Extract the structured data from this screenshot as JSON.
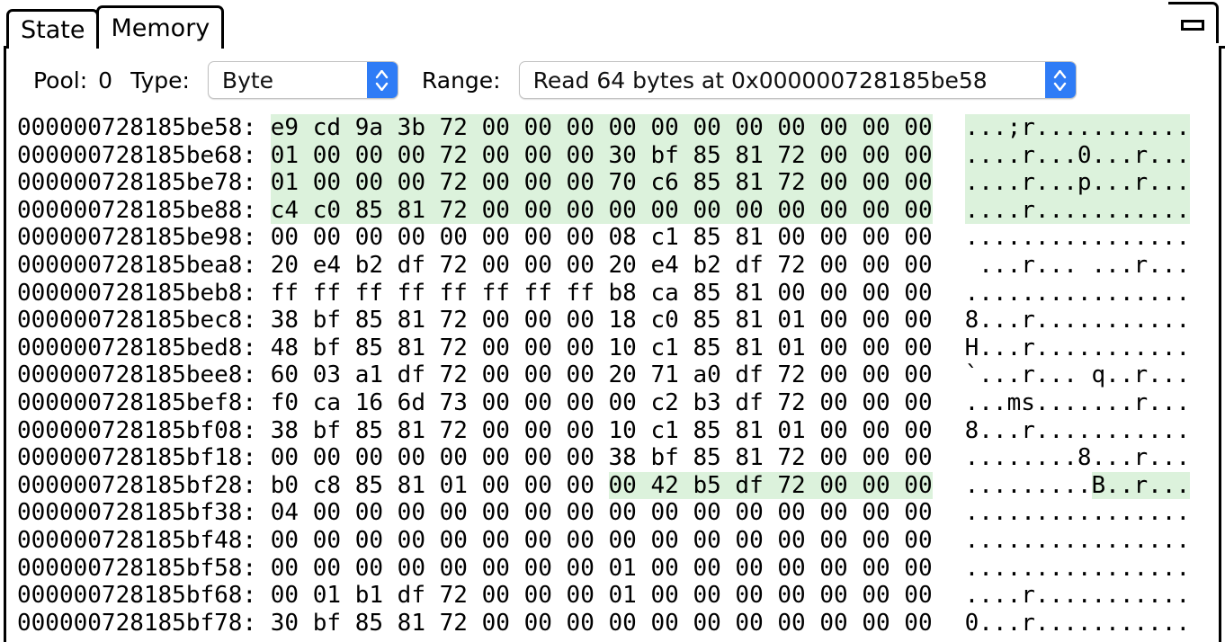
{
  "window": {
    "minimize_icon": "minimize-icon"
  },
  "tabs": [
    {
      "label": "State",
      "active": false
    },
    {
      "label": "Memory",
      "active": true
    }
  ],
  "toolbar": {
    "pool_label": "Pool:",
    "pool_value": "0",
    "type_label": "Type:",
    "type_value": "Byte",
    "type_options": [
      "Byte"
    ],
    "range_label": "Range:",
    "range_value": "Read 64 bytes at 0x000000728185be58",
    "range_options": [
      "Read 64 bytes at 0x000000728185be58"
    ],
    "stepper_icon": "chevron-up-down-icon"
  },
  "memory": {
    "highlight_color": "#dcf2dc",
    "bytes_per_row": 16,
    "rows": [
      {
        "address": "000000728185be58:",
        "bytes": [
          "e9",
          "cd",
          "9a",
          "3b",
          "72",
          "00",
          "00",
          "00",
          "00",
          "00",
          "00",
          "00",
          "00",
          "00",
          "00",
          "00"
        ],
        "ascii": "...;r...........",
        "hex_highlight": [
          0,
          16
        ],
        "ascii_highlight": [
          0,
          16
        ]
      },
      {
        "address": "000000728185be68:",
        "bytes": [
          "01",
          "00",
          "00",
          "00",
          "72",
          "00",
          "00",
          "00",
          "30",
          "bf",
          "85",
          "81",
          "72",
          "00",
          "00",
          "00"
        ],
        "ascii": "....r...0...r...",
        "hex_highlight": [
          0,
          16
        ],
        "ascii_highlight": [
          0,
          16
        ]
      },
      {
        "address": "000000728185be78:",
        "bytes": [
          "01",
          "00",
          "00",
          "00",
          "72",
          "00",
          "00",
          "00",
          "70",
          "c6",
          "85",
          "81",
          "72",
          "00",
          "00",
          "00"
        ],
        "ascii": "....r...p...r...",
        "hex_highlight": [
          0,
          16
        ],
        "ascii_highlight": [
          0,
          16
        ]
      },
      {
        "address": "000000728185be88:",
        "bytes": [
          "c4",
          "c0",
          "85",
          "81",
          "72",
          "00",
          "00",
          "00",
          "00",
          "00",
          "00",
          "00",
          "00",
          "00",
          "00",
          "00"
        ],
        "ascii": "....r...........",
        "hex_highlight": [
          0,
          16
        ],
        "ascii_highlight": [
          0,
          16
        ]
      },
      {
        "address": "000000728185be98:",
        "bytes": [
          "00",
          "00",
          "00",
          "00",
          "00",
          "00",
          "00",
          "00",
          "08",
          "c1",
          "85",
          "81",
          "00",
          "00",
          "00",
          "00"
        ],
        "ascii": "................",
        "hex_highlight": null,
        "ascii_highlight": null
      },
      {
        "address": "000000728185bea8:",
        "bytes": [
          "20",
          "e4",
          "b2",
          "df",
          "72",
          "00",
          "00",
          "00",
          "20",
          "e4",
          "b2",
          "df",
          "72",
          "00",
          "00",
          "00"
        ],
        "ascii": " ...r... ...r...",
        "hex_highlight": null,
        "ascii_highlight": null
      },
      {
        "address": "000000728185beb8:",
        "bytes": [
          "ff",
          "ff",
          "ff",
          "ff",
          "ff",
          "ff",
          "ff",
          "ff",
          "b8",
          "ca",
          "85",
          "81",
          "00",
          "00",
          "00",
          "00"
        ],
        "ascii": "................",
        "hex_highlight": null,
        "ascii_highlight": null
      },
      {
        "address": "000000728185bec8:",
        "bytes": [
          "38",
          "bf",
          "85",
          "81",
          "72",
          "00",
          "00",
          "00",
          "18",
          "c0",
          "85",
          "81",
          "01",
          "00",
          "00",
          "00"
        ],
        "ascii": "8...r...........",
        "hex_highlight": null,
        "ascii_highlight": null
      },
      {
        "address": "000000728185bed8:",
        "bytes": [
          "48",
          "bf",
          "85",
          "81",
          "72",
          "00",
          "00",
          "00",
          "10",
          "c1",
          "85",
          "81",
          "01",
          "00",
          "00",
          "00"
        ],
        "ascii": "H...r...........",
        "hex_highlight": null,
        "ascii_highlight": null
      },
      {
        "address": "000000728185bee8:",
        "bytes": [
          "60",
          "03",
          "a1",
          "df",
          "72",
          "00",
          "00",
          "00",
          "20",
          "71",
          "a0",
          "df",
          "72",
          "00",
          "00",
          "00"
        ],
        "ascii": "`...r... q..r...",
        "hex_highlight": null,
        "ascii_highlight": null
      },
      {
        "address": "000000728185bef8:",
        "bytes": [
          "f0",
          "ca",
          "16",
          "6d",
          "73",
          "00",
          "00",
          "00",
          "00",
          "c2",
          "b3",
          "df",
          "72",
          "00",
          "00",
          "00"
        ],
        "ascii": "...ms.......r...",
        "hex_highlight": null,
        "ascii_highlight": null
      },
      {
        "address": "000000728185bf08:",
        "bytes": [
          "38",
          "bf",
          "85",
          "81",
          "72",
          "00",
          "00",
          "00",
          "10",
          "c1",
          "85",
          "81",
          "01",
          "00",
          "00",
          "00"
        ],
        "ascii": "8...r...........",
        "hex_highlight": null,
        "ascii_highlight": null
      },
      {
        "address": "000000728185bf18:",
        "bytes": [
          "00",
          "00",
          "00",
          "00",
          "00",
          "00",
          "00",
          "00",
          "38",
          "bf",
          "85",
          "81",
          "72",
          "00",
          "00",
          "00"
        ],
        "ascii": "........8...r...",
        "hex_highlight": null,
        "ascii_highlight": null
      },
      {
        "address": "000000728185bf28:",
        "bytes": [
          "b0",
          "c8",
          "85",
          "81",
          "01",
          "00",
          "00",
          "00",
          "00",
          "42",
          "b5",
          "df",
          "72",
          "00",
          "00",
          "00"
        ],
        "ascii": ".........B..r...",
        "hex_highlight": [
          8,
          16
        ],
        "ascii_highlight": [
          9,
          16
        ]
      },
      {
        "address": "000000728185bf38:",
        "bytes": [
          "04",
          "00",
          "00",
          "00",
          "00",
          "00",
          "00",
          "00",
          "00",
          "00",
          "00",
          "00",
          "00",
          "00",
          "00",
          "00"
        ],
        "ascii": "................",
        "hex_highlight": null,
        "ascii_highlight": null
      },
      {
        "address": "000000728185bf48:",
        "bytes": [
          "00",
          "00",
          "00",
          "00",
          "00",
          "00",
          "00",
          "00",
          "00",
          "00",
          "00",
          "00",
          "00",
          "00",
          "00",
          "00"
        ],
        "ascii": "................",
        "hex_highlight": null,
        "ascii_highlight": null
      },
      {
        "address": "000000728185bf58:",
        "bytes": [
          "00",
          "00",
          "00",
          "00",
          "00",
          "00",
          "00",
          "00",
          "01",
          "00",
          "00",
          "00",
          "00",
          "00",
          "00",
          "00"
        ],
        "ascii": "................",
        "hex_highlight": null,
        "ascii_highlight": null
      },
      {
        "address": "000000728185bf68:",
        "bytes": [
          "00",
          "01",
          "b1",
          "df",
          "72",
          "00",
          "00",
          "00",
          "01",
          "00",
          "00",
          "00",
          "00",
          "00",
          "00",
          "00"
        ],
        "ascii": "....r...........",
        "hex_highlight": null,
        "ascii_highlight": null
      },
      {
        "address": "000000728185bf78:",
        "bytes": [
          "30",
          "bf",
          "85",
          "81",
          "72",
          "00",
          "00",
          "00",
          "00",
          "00",
          "00",
          "00",
          "00",
          "00",
          "00",
          "00"
        ],
        "ascii": "0...r...........",
        "hex_highlight": null,
        "ascii_highlight": null
      }
    ]
  }
}
